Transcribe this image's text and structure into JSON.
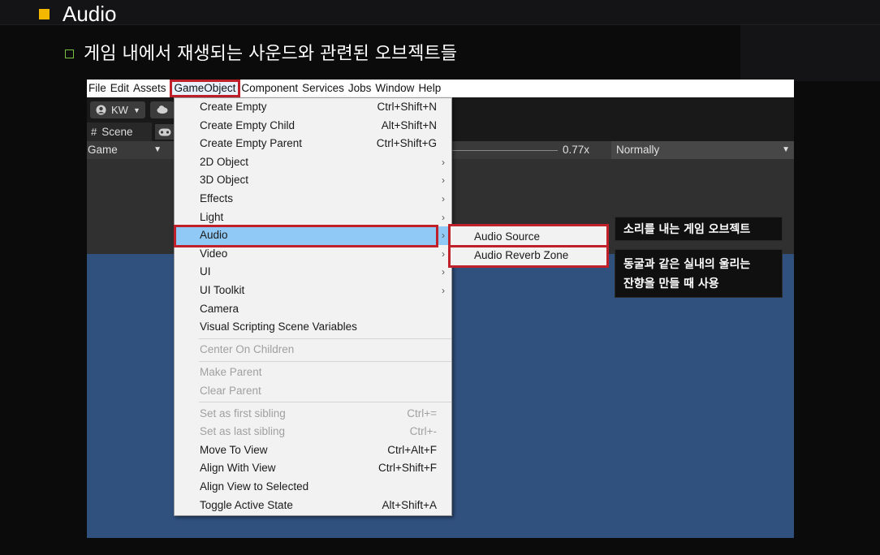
{
  "slide": {
    "title": "Audio",
    "subtitle": "게임 내에서 재생되는 사운드와 관련된 오브젝트들"
  },
  "colors": {
    "accent_bullet": "#f5b800",
    "sub_bullet": "#7bc043",
    "highlight_box": "#c0202a",
    "menu_selection": "#90c8f6",
    "scene_blue": "#30507e"
  },
  "menubar": {
    "items": [
      "File",
      "Edit",
      "Assets",
      "GameObject",
      "Component",
      "Services",
      "Jobs",
      "Window",
      "Help"
    ],
    "active": "GameObject"
  },
  "toolbar": {
    "account_label": "KW",
    "account_icon": "user-icon",
    "cloud_icon": "cloud-icon"
  },
  "tabs": {
    "scene_label": "Scene",
    "scene_icon": "grid-icon",
    "game_icon": "gamepad-icon"
  },
  "gamebar": {
    "display_select": "Game",
    "zoom_value": "0.77x",
    "aspect_select": "Normally"
  },
  "gameobject_menu": {
    "items": [
      {
        "label": "Create Empty",
        "shortcut": "Ctrl+Shift+N"
      },
      {
        "label": "Create Empty Child",
        "shortcut": "Alt+Shift+N"
      },
      {
        "label": "Create Empty Parent",
        "shortcut": "Ctrl+Shift+G"
      },
      {
        "label": "2D Object",
        "submenu": true
      },
      {
        "label": "3D Object",
        "submenu": true
      },
      {
        "label": "Effects",
        "submenu": true
      },
      {
        "label": "Light",
        "submenu": true
      },
      {
        "label": "Audio",
        "submenu": true,
        "selected": true
      },
      {
        "label": "Video",
        "submenu": true
      },
      {
        "label": "UI",
        "submenu": true
      },
      {
        "label": "UI Toolkit",
        "submenu": true
      },
      {
        "label": "Camera"
      },
      {
        "label": "Visual Scripting Scene Variables"
      },
      {
        "label": "Center On Children",
        "disabled": true
      },
      {
        "label": "Make Parent",
        "disabled": true
      },
      {
        "label": "Clear Parent",
        "disabled": true
      },
      {
        "label": "Set as first sibling",
        "shortcut": "Ctrl+=",
        "disabled": true
      },
      {
        "label": "Set as last sibling",
        "shortcut": "Ctrl+-",
        "disabled": true
      },
      {
        "label": "Move To View",
        "shortcut": "Ctrl+Alt+F"
      },
      {
        "label": "Align With View",
        "shortcut": "Ctrl+Shift+F"
      },
      {
        "label": "Align View to Selected"
      },
      {
        "label": "Toggle Active State",
        "shortcut": "Alt+Shift+A"
      }
    ]
  },
  "audio_submenu": {
    "items": [
      "Audio Source",
      "Audio Reverb Zone"
    ]
  },
  "callouts": {
    "audio_source": "소리를 내는 게임 오브젝트",
    "reverb_line1": "동굴과 같은 실내의 울리는",
    "reverb_line2": "잔향을 만들 때 사용"
  }
}
